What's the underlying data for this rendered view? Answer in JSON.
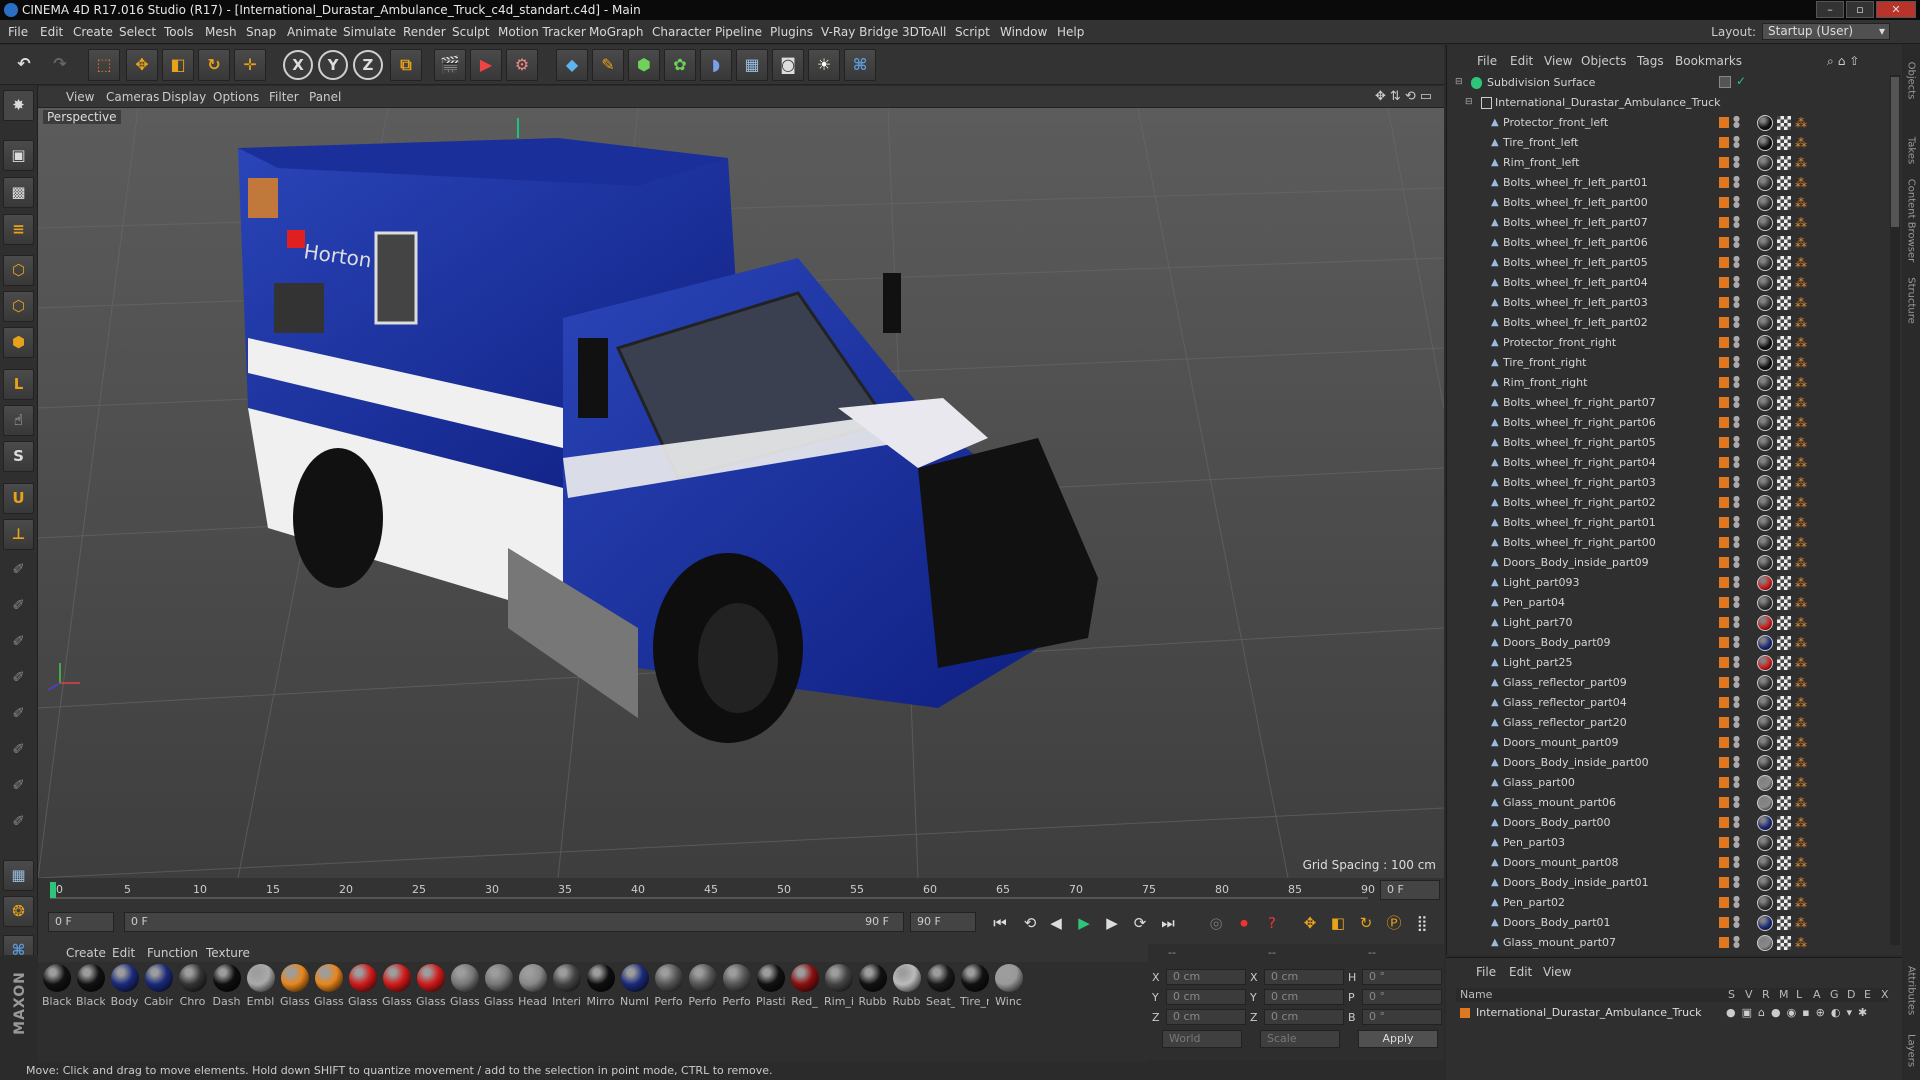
{
  "window": {
    "title": "CINEMA 4D R17.016 Studio (R17) - [International_Durastar_Ambulance_Truck_c4d_standart.c4d] - Main",
    "min": "–",
    "max": "▫",
    "close": "✕"
  },
  "menu": [
    "File",
    "Edit",
    "Create",
    "Select",
    "Tools",
    "Mesh",
    "Snap",
    "Animate",
    "Simulate",
    "Render",
    "Sculpt",
    "Motion Tracker",
    "MoGraph",
    "Character",
    "Pipeline",
    "Plugins",
    "V-Ray Bridge",
    "3DToAll",
    "Script",
    "Window",
    "Help"
  ],
  "layout": {
    "label": "Layout:",
    "value": "Startup (User)"
  },
  "toolbar": {
    "axis_x": "X",
    "axis_y": "Y",
    "axis_z": "Z"
  },
  "viewport": {
    "menu": [
      "View",
      "Cameras",
      "Display",
      "Options",
      "Filter",
      "Panel"
    ],
    "label": "Perspective",
    "grid_spacing": "Grid Spacing : 100 cm",
    "vehicle_logo": "Horton"
  },
  "timeline": {
    "ticks": [
      "0",
      "5",
      "10",
      "15",
      "20",
      "25",
      "30",
      "35",
      "40",
      "45",
      "50",
      "55",
      "60",
      "65",
      "70",
      "75",
      "80",
      "85",
      "90"
    ],
    "end_frame": "0 F"
  },
  "transport": {
    "current": "0 F",
    "range_start": "0 F",
    "range_end": "90 F",
    "max": "90 F"
  },
  "material_manager": {
    "menu": [
      "Create",
      "Edit",
      "Function",
      "Texture"
    ],
    "materials": [
      {
        "name": "Black",
        "color": "#111111"
      },
      {
        "name": "Black",
        "color": "#111111"
      },
      {
        "name": "Body",
        "color": "#1a2a7a"
      },
      {
        "name": "Cabin",
        "color": "#1a2a7a"
      },
      {
        "name": "Chro",
        "color": "#333333"
      },
      {
        "name": "Dash",
        "color": "#0e0e0e"
      },
      {
        "name": "Embl",
        "color": "#aaaaaa"
      },
      {
        "name": "Glass",
        "color": "#e8861d"
      },
      {
        "name": "Glass",
        "color": "#e8861d"
      },
      {
        "name": "Glass",
        "color": "#d11a1a"
      },
      {
        "name": "Glass",
        "color": "#d11a1a"
      },
      {
        "name": "Glass",
        "color": "#d11a1a"
      },
      {
        "name": "Glass",
        "color": "#777777"
      },
      {
        "name": "Glass",
        "color": "#777777"
      },
      {
        "name": "Head",
        "color": "#888888"
      },
      {
        "name": "Interi",
        "color": "#444444"
      },
      {
        "name": "Mirro",
        "color": "#0e0e0e"
      },
      {
        "name": "Numl",
        "color": "#1a2a7a"
      },
      {
        "name": "Perfo",
        "color": "#555555"
      },
      {
        "name": "Perfo",
        "color": "#555555"
      },
      {
        "name": "Perfo",
        "color": "#555555"
      },
      {
        "name": "Plasti",
        "color": "#111111"
      },
      {
        "name": "Red_",
        "color": "#8a0f0f"
      },
      {
        "name": "Rim_i",
        "color": "#444444"
      },
      {
        "name": "Rubb",
        "color": "#111111"
      },
      {
        "name": "Rubb",
        "color": "#bbbbbb"
      },
      {
        "name": "Seat_",
        "color": "#1a1a1a"
      },
      {
        "name": "Tire_r",
        "color": "#111111"
      },
      {
        "name": "Winc",
        "color": "#999999"
      }
    ]
  },
  "coordinates": {
    "rows": [
      {
        "a": "X",
        "av": "0 cm",
        "b": "X",
        "bv": "0 cm",
        "c": "H",
        "cv": "0 °"
      },
      {
        "a": "Y",
        "av": "0 cm",
        "b": "Y",
        "bv": "0 cm",
        "c": "P",
        "cv": "0 °"
      },
      {
        "a": "Z",
        "av": "0 cm",
        "b": "Z",
        "bv": "0 cm",
        "c": "B",
        "cv": "0 °"
      }
    ],
    "mode": "World",
    "scale": "Scale",
    "apply": "Apply",
    "h1": "--",
    "h2": "--",
    "h3": "--"
  },
  "status": "Move: Click and drag to move elements. Hold down SHIFT to quantize movement / add to the selection in point mode, CTRL to remove.",
  "object_manager": {
    "menu": [
      "File",
      "Edit",
      "View",
      "Objects",
      "Tags",
      "Bookmarks"
    ],
    "root": "Subdivision Surface",
    "group": "International_Durastar_Ambulance_Truck",
    "items": [
      {
        "name": "Protector_front_left",
        "tag": "#111111"
      },
      {
        "name": "Tire_front_left",
        "tag": "#111111"
      },
      {
        "name": "Rim_front_left",
        "tag": "#333333"
      },
      {
        "name": "Bolts_wheel_fr_left_part01",
        "tag": "#333333"
      },
      {
        "name": "Bolts_wheel_fr_left_part00",
        "tag": "#333333"
      },
      {
        "name": "Bolts_wheel_fr_left_part07",
        "tag": "#333333"
      },
      {
        "name": "Bolts_wheel_fr_left_part06",
        "tag": "#333333"
      },
      {
        "name": "Bolts_wheel_fr_left_part05",
        "tag": "#333333"
      },
      {
        "name": "Bolts_wheel_fr_left_part04",
        "tag": "#333333"
      },
      {
        "name": "Bolts_wheel_fr_left_part03",
        "tag": "#333333"
      },
      {
        "name": "Bolts_wheel_fr_left_part02",
        "tag": "#333333"
      },
      {
        "name": "Protector_front_right",
        "tag": "#111111"
      },
      {
        "name": "Tire_front_right",
        "tag": "#111111"
      },
      {
        "name": "Rim_front_right",
        "tag": "#333333"
      },
      {
        "name": "Bolts_wheel_fr_right_part07",
        "tag": "#333333"
      },
      {
        "name": "Bolts_wheel_fr_right_part06",
        "tag": "#333333"
      },
      {
        "name": "Bolts_wheel_fr_right_part05",
        "tag": "#333333"
      },
      {
        "name": "Bolts_wheel_fr_right_part04",
        "tag": "#333333"
      },
      {
        "name": "Bolts_wheel_fr_right_part03",
        "tag": "#333333"
      },
      {
        "name": "Bolts_wheel_fr_right_part02",
        "tag": "#333333"
      },
      {
        "name": "Bolts_wheel_fr_right_part01",
        "tag": "#333333"
      },
      {
        "name": "Bolts_wheel_fr_right_part00",
        "tag": "#333333"
      },
      {
        "name": "Doors_Body_inside_part09",
        "tag": "#333333"
      },
      {
        "name": "Light_part093",
        "tag": "#d11a1a"
      },
      {
        "name": "Pen_part04",
        "tag": "#333333"
      },
      {
        "name": "Light_part70",
        "tag": "#d11a1a"
      },
      {
        "name": "Doors_Body_part09",
        "tag": "#1a2a7a"
      },
      {
        "name": "Light_part25",
        "tag": "#d11a1a"
      },
      {
        "name": "Glass_reflector_part09",
        "tag": "#333333"
      },
      {
        "name": "Glass_reflector_part04",
        "tag": "#333333"
      },
      {
        "name": "Glass_reflector_part20",
        "tag": "#333333"
      },
      {
        "name": "Doors_mount_part09",
        "tag": "#333333"
      },
      {
        "name": "Doors_Body_inside_part00",
        "tag": "#333333"
      },
      {
        "name": "Glass_part00",
        "tag": "#888888"
      },
      {
        "name": "Glass_mount_part06",
        "tag": "#888888"
      },
      {
        "name": "Doors_Body_part00",
        "tag": "#1a2a7a"
      },
      {
        "name": "Pen_part03",
        "tag": "#333333"
      },
      {
        "name": "Doors_mount_part08",
        "tag": "#333333"
      },
      {
        "name": "Doors_Body_inside_part01",
        "tag": "#333333"
      },
      {
        "name": "Pen_part02",
        "tag": "#333333"
      },
      {
        "name": "Doors_Body_part01",
        "tag": "#1a2a7a"
      },
      {
        "name": "Glass_mount_part07",
        "tag": "#888888"
      }
    ]
  },
  "attributes": {
    "menu": [
      "File",
      "Edit",
      "View"
    ],
    "col_name": "Name",
    "cols": [
      "S",
      "V",
      "R",
      "M",
      "L",
      "A",
      "G",
      "D",
      "E",
      "X"
    ],
    "row": "International_Durastar_Ambulance_Truck"
  },
  "side_tabs": [
    "Objects",
    "Takes",
    "Content Browser",
    "Structure",
    "Attributes",
    "Layers"
  ]
}
